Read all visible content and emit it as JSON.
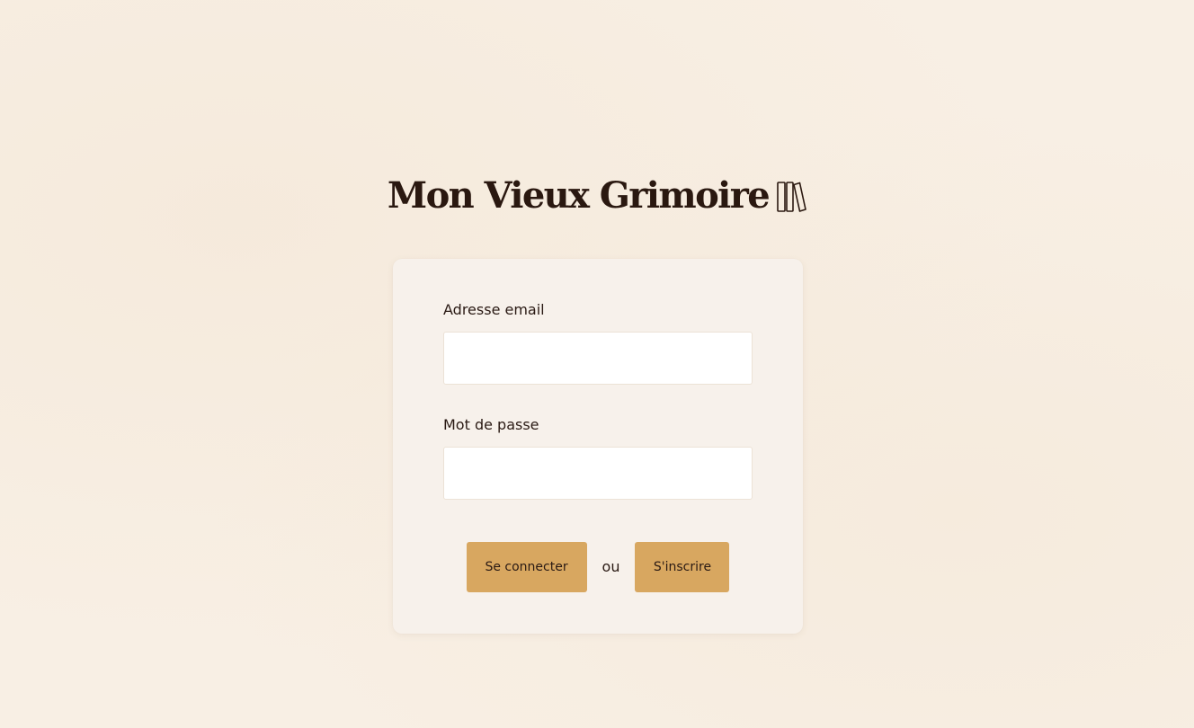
{
  "header": {
    "title": "Mon Vieux Grimoire",
    "icon": "books-icon"
  },
  "login_form": {
    "email_label": "Adresse email",
    "email_value": "",
    "password_label": "Mot de passe",
    "password_value": "",
    "login_button": "Se connecter",
    "separator": "ou",
    "signup_button": "S'inscrire"
  },
  "colors": {
    "background": "#f8efe4",
    "card": "#f7f1eb",
    "button": "#d8a760",
    "text": "#2a1a14"
  }
}
